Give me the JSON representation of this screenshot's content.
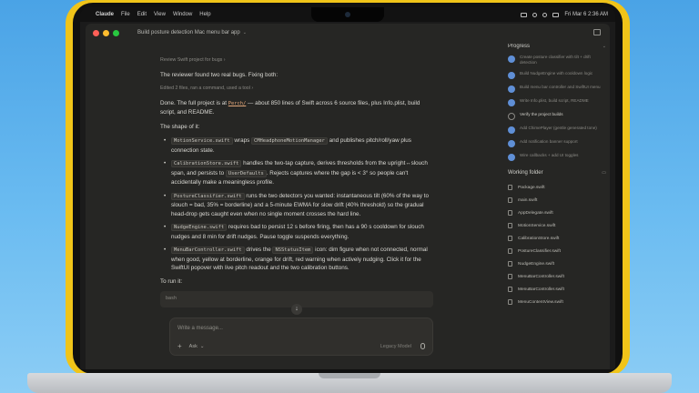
{
  "menubar": {
    "app_name": "Claude",
    "menus": [
      "File",
      "Edit",
      "View",
      "Window",
      "Help"
    ],
    "datetime": "Fri Mar 6  2:36 AM"
  },
  "window": {
    "title": "Build posture detection Mac menu bar app",
    "chevron": "⌄"
  },
  "chat": {
    "review_line": "Review Swift project for bugs",
    "review_chevron": "›",
    "reviewer_text": "The reviewer found two real bugs. Fixing both:",
    "edited_line": "Edited 2 files, ran a command, used a tool",
    "edited_chevron": "›",
    "done_text_1": "Done. The full project is at",
    "done_link": "Perch/",
    "done_text_2": "— about 850 lines of Swift across 6 source files, plus Info.plist, build script, and README.",
    "shape_heading": "The shape of it:",
    "bullets": [
      {
        "code": "MotionService.swift",
        "pre": " wraps ",
        "code2": "CMHeadphoneMotionManager",
        "text": " and publishes pitch/roll/yaw plus connection state."
      },
      {
        "code": "CalibrationStore.swift",
        "text": " handles the two-tap capture, derives thresholds from the upright↔slouch span, and persists to ",
        "code2": "UserDefaults",
        "post": ". Rejects captures where the gap is < 3° so people can't accidentally make a meaningless profile."
      },
      {
        "code": "PostureClassifier.swift",
        "text": " runs the two detectors you wanted: instantaneous tilt (60% of the way to slouch = bad, 35% = borderline) and a 5-minute EWMA for slow drift (40% threshold) so the gradual head-drop gets caught even when no single moment crosses the hard line."
      },
      {
        "code": "NudgeEngine.swift",
        "text": " requires bad to persist 12 s before firing, then has a 90 s cooldown for slouch nudges and 8 min for drift nudges. Pause toggle suspends everything."
      },
      {
        "code": "MenuBarController.swift",
        "text": " drives the ",
        "code2": "NSStatusItem",
        "post": " icon: dim figure when not connected, normal when good, yellow at borderline, orange for drift, red warning when actively nudging. Click it for the SwiftUI popover with live pitch readout and the two calibration buttons."
      }
    ],
    "to_run": "To run it:",
    "code_block_text": "bash"
  },
  "composer": {
    "placeholder": "Write a message...",
    "plus": "+",
    "ask_label": "Ask",
    "ask_chevron": "⌄",
    "mode_label": "Legacy Model",
    "scroll_arrow": "↓"
  },
  "sidebar": {
    "progress_title": "Progress",
    "progress_items": [
      {
        "label": "Create posture classifier with tilt + drift detection",
        "done": true
      },
      {
        "label": "Build NudgeEngine with cooldown logic",
        "done": true
      },
      {
        "label": "Build menu bar controller and SwiftUI menu",
        "done": true
      },
      {
        "label": "Write Info.plist, build script, README",
        "done": true
      },
      {
        "label": "Verify the project builds",
        "done": false
      },
      {
        "label": "Add ChimePlayer (gentle generated tone)",
        "done": true
      },
      {
        "label": "Add notification banner support",
        "done": true
      },
      {
        "label": "Wire callbacks + add UI toggles",
        "done": true
      }
    ],
    "folder_title": "Working folder",
    "files": [
      "Package.swift",
      "main.swift",
      "AppDelegate.swift",
      "MotionService.swift",
      "CalibrationStore.swift",
      "PostureClassifier.swift",
      "NudgeEngine.swift",
      "MenuBarController.swift",
      "MenuBarController.swift",
      "MenuContentView.swift"
    ]
  }
}
